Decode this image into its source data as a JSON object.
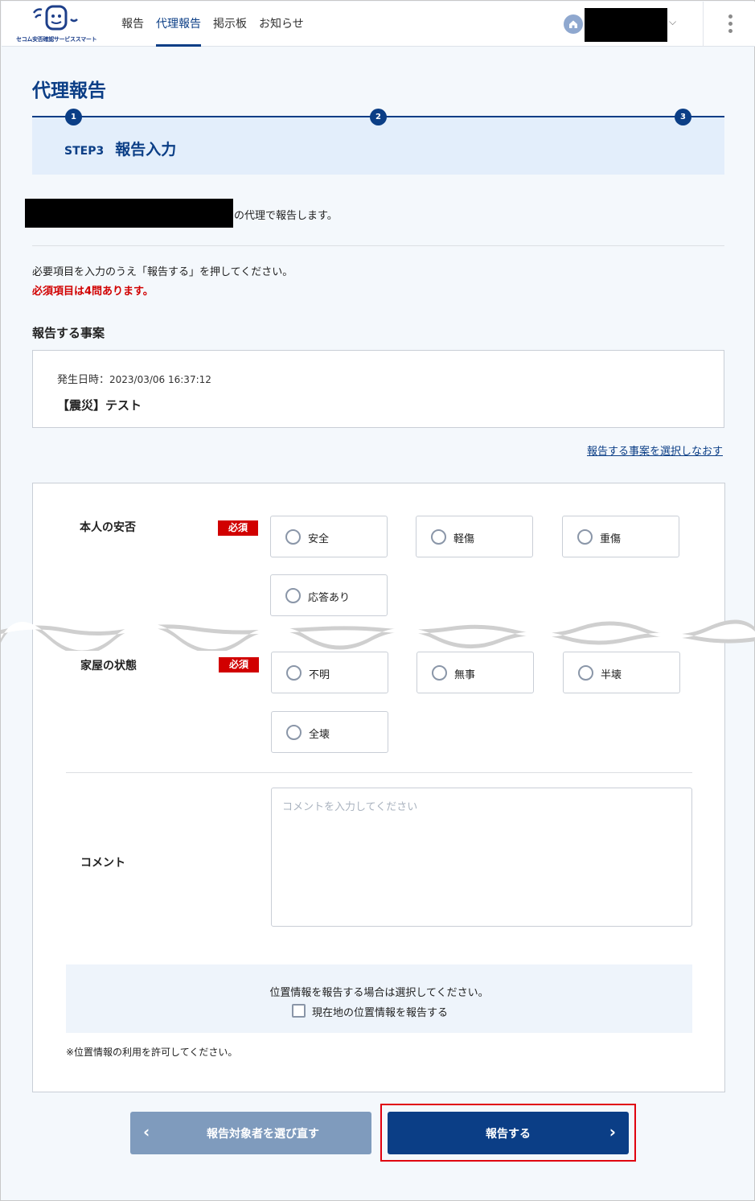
{
  "header": {
    "logo_text": "セコム安否確認サービススマート",
    "nav": [
      {
        "label": "報告"
      },
      {
        "label": "代理報告"
      },
      {
        "label": "掲示板"
      },
      {
        "label": "お知らせ"
      }
    ],
    "chevron": "⌵"
  },
  "page": {
    "title": "代理報告"
  },
  "stepper": {
    "steps": [
      "1",
      "2",
      "3"
    ],
    "current_num": "STEP3",
    "current_name": "報告入力"
  },
  "proxy": {
    "suffix": "の代理で報告します。"
  },
  "instructions": {
    "text": "必要項目を入力のうえ「報告する」を押してください。",
    "required": "必須項目は4問あります。"
  },
  "incident": {
    "heading": "報告する事案",
    "date_label": "発生日時：",
    "date_value": "2023/03/06 16:37:12",
    "name": "【震災】テスト",
    "reselect_link": "報告する事案を選択しなおす"
  },
  "questions": {
    "safety": {
      "label": "本人の安否",
      "badge": "必須",
      "options": [
        "安全",
        "軽傷",
        "重傷",
        "応答あり"
      ]
    },
    "house": {
      "label": "家屋の状態",
      "badge": "必須",
      "options": [
        "不明",
        "無事",
        "半壊",
        "全壊"
      ]
    }
  },
  "comment": {
    "label": "コメント",
    "placeholder": "コメントを入力してください"
  },
  "location": {
    "prompt": "位置情報を報告する場合は選択してください。",
    "checkbox_label": "現在地の位置情報を報告する",
    "note": "※位置情報の利用を許可してください。"
  },
  "buttons": {
    "back_label": "報告対象者を選び直す",
    "back_chevron": "‹",
    "submit_label": "報告する",
    "submit_chevron": "›"
  },
  "colors": {
    "primary": "#0b3e86",
    "required": "#d10000",
    "highlight": "#e0000f"
  }
}
